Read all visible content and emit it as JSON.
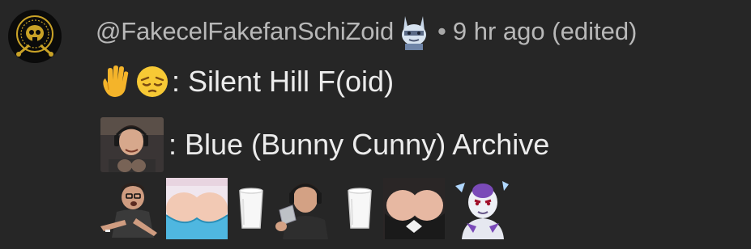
{
  "comment": {
    "username": "@FakecelFakefanSchiZoid",
    "separator": "•",
    "timestamp": "9 hr ago (edited)",
    "line1": {
      "emojis": [
        "raised-hand-emoji",
        "pensive-face-emoji"
      ],
      "text": ": Silent Hill F(oid)"
    },
    "line2": {
      "image": "streamer-portrait",
      "text": ": Blue (Bunny Cunny) Archive"
    },
    "line3": {
      "stickers": [
        "pointing-man-sticker",
        "bunny-girl-sticker",
        "milk-glass-sticker",
        "drinking-man-sticker",
        "milk-glass-sticker",
        "bunny-girl-sticker",
        "frieza-sticker"
      ]
    }
  },
  "colors": {
    "background": "#262626",
    "meta_text": "#b8b8b8",
    "body_text": "#ececec"
  }
}
